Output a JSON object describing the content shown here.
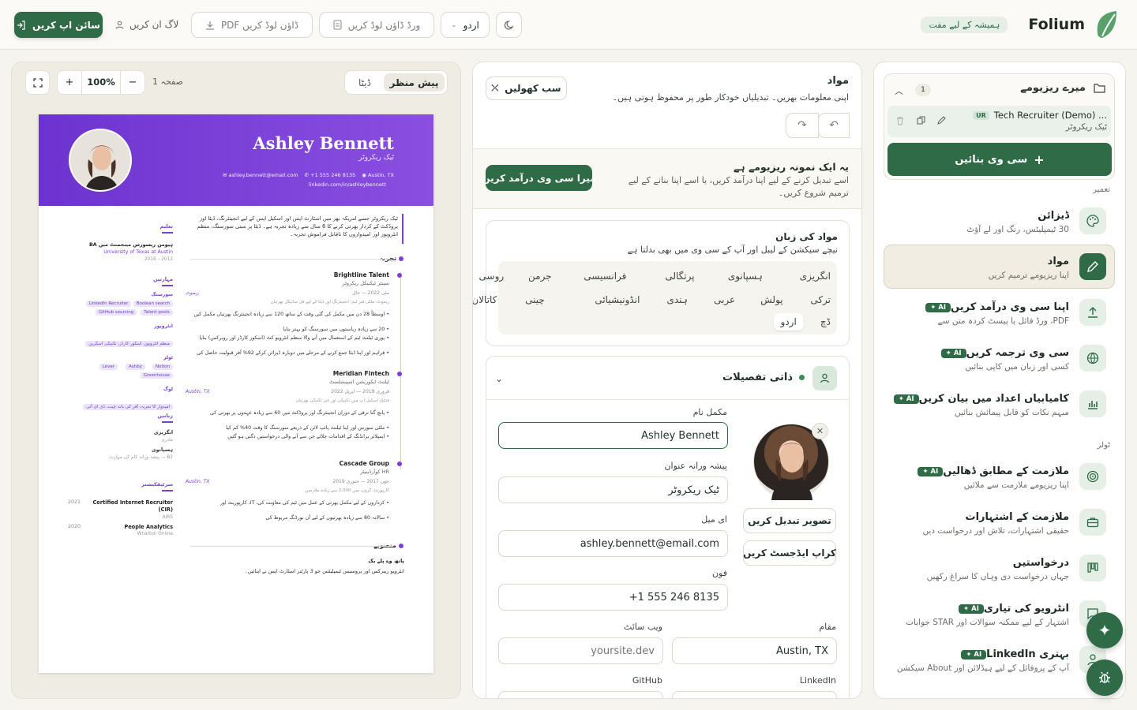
{
  "header": {
    "logo_text": "Folium",
    "free_badge": "ہمیشہ کے لیے مفت",
    "theme_toggle_icon": "moon-icon",
    "language_select": "اردو",
    "word_download": "ورڈ ڈاؤن لوڈ کریں",
    "pdf_download": "PDF ڈاؤن لوڈ کریں",
    "login": "لاگ ان کریں",
    "signup": "سائن اپ کریں"
  },
  "sidebar": {
    "my_resumes": "میرے ریزیومے",
    "resume_count": "1",
    "resume_item": {
      "title": "Tech Recruiter (Demo) ...",
      "lang_badge": "UR",
      "subtitle": "ٹیک ریکروٹر"
    },
    "create_cv": "سی وی بنائیں",
    "section_build": "تعمیر",
    "section_tools": "ٹولز",
    "ai_badge": "AI",
    "items": [
      {
        "title": "ڈیزائن",
        "sub": "30 ٹیمپلیٹس، رنگ اور لے آؤٹ",
        "icon": "palette-icon",
        "ai": false
      },
      {
        "title": "مواد",
        "sub": "اپنا ریزیومے ترمیم کریں",
        "icon": "pencil-icon",
        "ai": false
      },
      {
        "title": "اپنا سی وی درآمد کریں",
        "sub": "PDF، ورڈ فائل یا پیسٹ کردہ متن سے",
        "icon": "upload-icon",
        "ai": true
      },
      {
        "title": "سی وی ترجمہ کریں",
        "sub": "کسی اور زبان میں کاپی بنائیں",
        "icon": "globe-icon",
        "ai": true
      },
      {
        "title": "کامیابیاں اعداد میں بیان کریں",
        "sub": "مبہم نکات کو قابل پیمائش بنائیں",
        "icon": "bar-chart-icon",
        "ai": true
      },
      {
        "title": "ملازمت کے مطابق ڈھالیں",
        "sub": "اپنا ریزیومے ملازمت سے ملائیں",
        "icon": "target-icon",
        "ai": true
      },
      {
        "title": "ملازمت کے اشتہارات",
        "sub": "حقیقی اشتہارات، تلاش اور درخواست دیں",
        "icon": "briefcase-icon",
        "ai": false
      },
      {
        "title": "درخواستیں",
        "sub": "جہاں درخواست دی وہاں کا سراغ رکھیں",
        "icon": "kanban-icon",
        "ai": false
      },
      {
        "title": "انٹرویو کی تیاری",
        "sub": "اشتہار کے لیے ممکنہ سوالات اور STAR جوابات",
        "icon": "chat-icon",
        "ai": true
      },
      {
        "title": "LinkedIn بہتری",
        "sub": "آپ کے پروفائل کے لیے ہیڈلائن اور About سیکشن",
        "icon": "user-icon",
        "ai": true
      }
    ]
  },
  "editor": {
    "content_title": "مواد",
    "content_sub": "اپنی معلومات بھریں۔ تبدیلیاں خودکار طور پر محفوظ ہوتی ہیں۔",
    "open_all": "سب کھولیں",
    "sample_title": "یہ ایک نمونہ ریزیومے ہے",
    "sample_sub": "اسے تبدیل کرنے کے لیے اپنا درآمد کریں، یا اسے اپنا بنانے کے لیے ترمیم شروع کریں۔",
    "import_my_cv": "میرا سی وی درآمد کریں",
    "content_lang_title": "مواد کی زبان",
    "content_lang_sub": "نیچے سیکشن کے لیبل اور آپ کے سی وی میں بھی بدلتا ہے",
    "languages_row1": [
      "انگریزی",
      "ہسپانوی",
      "پرتگالی",
      "فرانسیسی",
      "جرمن",
      "روسی"
    ],
    "languages_row2": [
      "ترکی",
      "پولش",
      "عربی",
      "ہندی",
      "انڈونیشیائی",
      "چینی",
      "کاتالان"
    ],
    "languages_row3": [
      "ڈچ",
      "اردو"
    ],
    "personal_title": "ذاتی تفصیلات",
    "change_photo": "تصویر تبدیل کریں",
    "adjust_crop": "کراپ ایڈجسٹ کریں",
    "fields": {
      "full_name": {
        "label": "مکمل نام",
        "value": "Ashley Bennett"
      },
      "job_title": {
        "label": "پیشہ ورانہ عنوان",
        "value": "ٹیک ریکروٹر"
      },
      "email": {
        "label": "ای میل",
        "value": "ashley.bennett@email.com"
      },
      "phone": {
        "label": "فون",
        "value": "+1 555 246 8135"
      },
      "location": {
        "label": "مقام",
        "value": "Austin, TX"
      },
      "website": {
        "label": "ویب سائٹ",
        "placeholder": "yoursite.dev"
      },
      "linkedin": {
        "label": "LinkedIn"
      },
      "github": {
        "label": "GitHub"
      }
    }
  },
  "preview": {
    "tab_preview": "پیش منظر",
    "tab_data": "ڈیٹا",
    "zoom": "100%",
    "page": "1 صفحہ",
    "resume": {
      "name": "Ashley Bennett",
      "title": "ٹیک ریکروٹر",
      "location": "Austin, TX",
      "phone": "+1 555 246 8135",
      "email": "ashley.bennett@email.com",
      "linkedin": "linkedin.com/in/ashleybennett",
      "summary": "ٹیک ریکروٹر جسے امریکہ بھر میں اسٹارٹ اپس اور اسکیل اپس کے لیے انجینئرنگ، ڈیٹا اور پروڈکٹ کے کردار بھرتی کرنے کا 6 سال سے زیادہ تجربہ ہے۔ ڈیٹا پر مبنی سورسنگ، منظم انٹرویوز اور امیدواروں کا ناقابل فراموش تجربہ۔",
      "experience_label": "تجربہ",
      "jobs": [
        {
          "company": "Brightline Talent",
          "role": "سینئر ٹیکنیکل ریکروٹر",
          "dates": "مئی 2022 — حال",
          "loc": "ریموٹ",
          "note": "ریموٹ، ملٹی فیز ٹیم؛ انجینئرنگ اور ڈیٹا کے لیے فل سائیکل بھرتیاں",
          "bullets": [
            "اوسطاً 28 دن میں مکمل کی گئی وقت کے ساتھ 120 سے زیادہ انجینئرنگ بھرتیاں مکمل کیں",
            "20 سے زیادہ ریاستوں میں سورسنگ کو بہتر بنایا",
            "پوری ٹیلنٹ ٹیم کے استعمال میں آنے والا منظم انٹرویو کٹ (اسکور کارڈز اور روبرکس) بنایا",
            "فراہم اور اپنا ڈیٹا جمع کرنے کے مرحلے میں دوبارہ ڈیزائن کرکے 92% آفر قبولیت حاصل کی"
          ]
        },
        {
          "company": "Meridian Fintech",
          "role": "ٹیلنٹ ایکوزیشن اسپیشلسٹ",
          "dates": "فروری 2019 — اپریل 2022",
          "loc": "Austin, TX",
          "note": "فنٹیک اسکیل اپ میں تکنیکی اور غیر تکنیکی بھرتیاں",
          "bullets": [
            "پانچ گنا ترقی کے دوران انجینئرنگ اور پروڈکٹ میں 60 سے زیادہ عہدوں پر بھرتی کی",
            "ملٹی سورس اور اپنا ٹیلنٹ پائپ لائن کے ذریعے سورسنگ کا وقت 40% کم کیا",
            "ایمپلائر برانڈنگ کے اقدامات چلائے جن سے آنے والی درخواستیں دگنی ہو گئیں"
          ]
        },
        {
          "company": "Cascade Group",
          "role": "HR کوآرڈینیٹر",
          "dates": "جون 2017 — جنوری 2019",
          "loc": "Austin, TX",
          "note": "کارپوریٹ گروپ میں 2,000 سے زیادہ ملازمین",
          "bullets": [
            "کرداروں کے لیے مکمل بھرتی کے عمل میں ٹیم کی معاونت کی، IT، کارپوریٹ اور",
            "سالانہ 80 سے زیادہ بھرتیوں کے لیے آن بورڈنگ مربوط کی"
          ]
        }
      ],
      "projects_label": "منصوبے",
      "project": {
        "name": "پاتھ وے پلے بک",
        "desc": "انٹرویو ریبرکس اور پروسیس ٹیمپلیٹس جو 3 پارٹنر اسٹارٹ اپس نے اپنائیں۔"
      },
      "education_label": "تعلیم",
      "education": {
        "degree": "BA ہیومن ریسورس مینجمنٹ میں",
        "school": "University of Texas at Austin",
        "years": "2012 – 2016"
      },
      "skills_label": "مہارتیں",
      "skill_groups": [
        {
          "name": "سورسنگ",
          "tags": [
            "Boolean search",
            "LinkedIn Recruiter",
            "Talent pools",
            "GitHub sourcing"
          ]
        },
        {
          "name": "انٹرویوز",
          "tags": [
            "منظم انٹرویوز، اسکور کارڈز، تکنیکی اسکرین"
          ]
        },
        {
          "name": "ٹولز",
          "tags": [
            "Notion",
            "Ashby",
            "Lever",
            "Greenhouse"
          ]
        },
        {
          "name": "لوگ",
          "tags": [
            "امیدوار کا تجربہ، آفر کی بات چیت، ڈی ای آئی"
          ]
        }
      ],
      "languages_label": "زبانیں",
      "languages": [
        {
          "name": "انگریزی",
          "level": "مادری"
        },
        {
          "name": "ہسپانوی",
          "level": "B2 — پیشہ ورانہ کام کی مہارت"
        }
      ],
      "certs_label": "سرٹیفکیشنز",
      "certs": [
        {
          "year": "2021",
          "name": "Certified Internet Recruiter (CIR)",
          "org": "AIRS"
        },
        {
          "year": "2020",
          "name": "People Analytics",
          "org": "Wharton Online"
        }
      ]
    }
  },
  "fab": {
    "sparkle": "sparkle-icon",
    "bug": "bug-icon"
  },
  "colors": {
    "accent": "#2f6b46",
    "cv_purple": "#7b3fd3"
  }
}
